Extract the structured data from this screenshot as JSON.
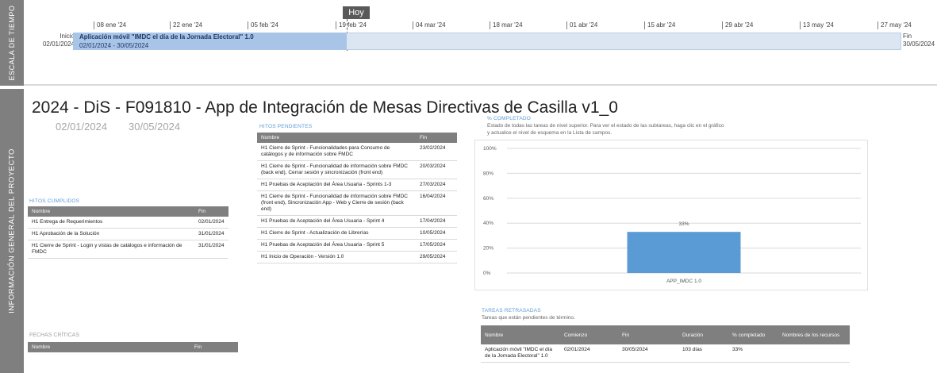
{
  "timeline": {
    "side_label": "ESCALA DE TIEMPO",
    "today_label": "Hoy",
    "ticks": [
      "08 ene '24",
      "22 ene '24",
      "05 feb '24",
      "19 feb '24",
      "04 mar '24",
      "18 mar '24",
      "01 abr '24",
      "15 abr '24",
      "29 abr '24",
      "13 may '24",
      "27 may '24"
    ],
    "start_word": "Inicio",
    "start_date": "02/01/2024",
    "finish_word": "Fin",
    "finish_date": "30/05/2024",
    "bar_title": "Aplicación móvil \"IMDC el día de la Jornada Electoral\" 1.0",
    "bar_dates": "02/01/2024 - 30/05/2024",
    "bar_progress_fraction": 0.33
  },
  "project": {
    "side_label": "INFORMACIÓN GENERAL DEL PROYECTO",
    "title": "2024 - DiS - F091810 - App de Integración de Mesas Directivas de Casilla v1_0",
    "start": "02/01/2024",
    "finish": "30/05/2024"
  },
  "hitos_cumplidos": {
    "heading": "HITOS CUMPLIDOS",
    "columns": [
      "Nombre",
      "Fin"
    ],
    "rows": [
      [
        "H1 Entrega de Requerimientos",
        "02/01/2024"
      ],
      [
        "H1 Aprobación de la Solución",
        "31/01/2024"
      ],
      [
        "H1 Cierre de Sprint - Login y vistas de catálogos e información de FMDC",
        "31/01/2024"
      ]
    ]
  },
  "hitos_pendientes": {
    "heading": "HITOS PENDIENTES",
    "columns": [
      "Nombre",
      "Fin"
    ],
    "rows": [
      [
        "H1 Cierre de Sprint - Funcionalidades para Consumo de catálogos y de información sobre FMDC",
        "23/02/2024"
      ],
      [
        "H1 Cierre de Sprint - Funcionalidad de información sobre FMDC (back end), Cerrar sesión y sincronización (front end)",
        "20/03/2024"
      ],
      [
        "H1 Pruebas de Aceptación del Área Usuaria - Sprints 1-3",
        "27/03/2024"
      ],
      [
        "H1 Cierre de Sprint - Funcionalidad de información sobre FMDC (front end), Sincronización App - Web y Cierre de sesión (back end)",
        "16/04/2024"
      ],
      [
        "H1 Pruebas de Aceptación del Área Usuaria - Sprint 4",
        "17/04/2024"
      ],
      [
        "H1 Cierre de Sprint - Actualización de Librerías",
        "10/05/2024"
      ],
      [
        "H1 Pruebas de Aceptación del Área Usuaria - Sprint 5",
        "17/05/2024"
      ],
      [
        "H1 Inicio de Operación - Versión 1.0",
        "29/05/2024"
      ]
    ]
  },
  "fechas_criticas": {
    "heading": "FECHAS CRÍTICAS",
    "columns": [
      "Nombre",
      "Fin"
    ]
  },
  "completado": {
    "heading": "% COMPLETADO",
    "description": "Estado de todas las tareas de nivel superior. Para ver el estado de las subtareas, haga clic en el gráfico y actualice el nivel de esquema en la Lista de campos."
  },
  "chart_data": {
    "type": "bar",
    "categories": [
      "APP_IMDC 1.0"
    ],
    "values": [
      33
    ],
    "value_labels": [
      "33%"
    ],
    "ylim": [
      0,
      100
    ],
    "yticks": [
      "0%",
      "20%",
      "40%",
      "60%",
      "80%",
      "100%"
    ],
    "bar_color": "#5b9bd5",
    "grid": true
  },
  "tareas_retrasadas": {
    "heading": "TAREAS RETRASADAS",
    "description": "Tareas que están pendientes de término.",
    "columns": [
      "Nombre",
      "Comienzo",
      "Fin",
      "Duración",
      "% completado",
      "Nombres de los recursos"
    ],
    "rows": [
      [
        "Aplicación móvil \"IMDC el día de la Jornada Electoral\" 1.0",
        "02/01/2024",
        "30/05/2024",
        "103 días",
        "33%",
        ""
      ]
    ]
  },
  "colors": {
    "side_bar": "#7f7f7f",
    "header_accent": "#5b9bd5",
    "bar_done": "#a8c5e8",
    "bar_remaining": "#dce6f3"
  }
}
